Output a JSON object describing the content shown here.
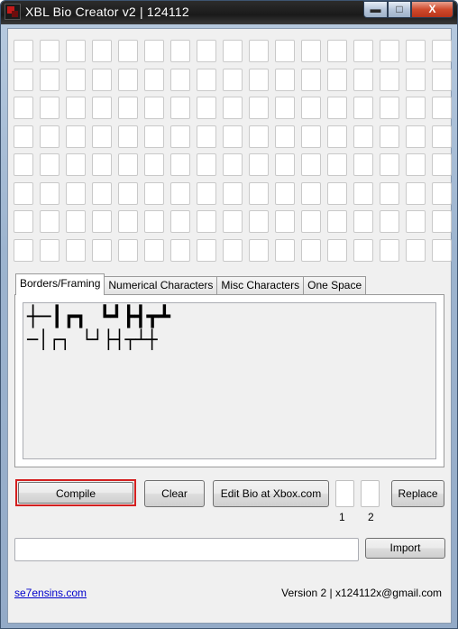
{
  "window": {
    "title": "XBL Bio Creator v2 | 124112",
    "controls": {
      "minimize": "▬",
      "maximize": "□",
      "close": "X"
    }
  },
  "grid": {
    "rows": 8,
    "columns": 17
  },
  "tabs": [
    {
      "label": "Borders/Framing",
      "active": true
    },
    {
      "label": "Numerical Characters",
      "active": false
    },
    {
      "label": "Misc Characters",
      "active": false
    },
    {
      "label": "One Space",
      "active": false
    }
  ],
  "framing": {
    "line1": "┼─┃┏┓ ┗┛┣┫┳┻",
    "line2": "─│┌┐ └┘├┤┬┴┼"
  },
  "buttons": {
    "compile": "Compile",
    "clear": "Clear",
    "edit_bio": "Edit Bio at Xbox.com",
    "replace": "Replace",
    "import": "Import"
  },
  "replace_boxes": {
    "label1": "1",
    "label2": "2"
  },
  "footer": {
    "link": "se7ensins.com",
    "version": "Version 2 | x124112x@gmail.com"
  },
  "colors": {
    "highlight": "#d42020",
    "link": "#0000cc"
  }
}
